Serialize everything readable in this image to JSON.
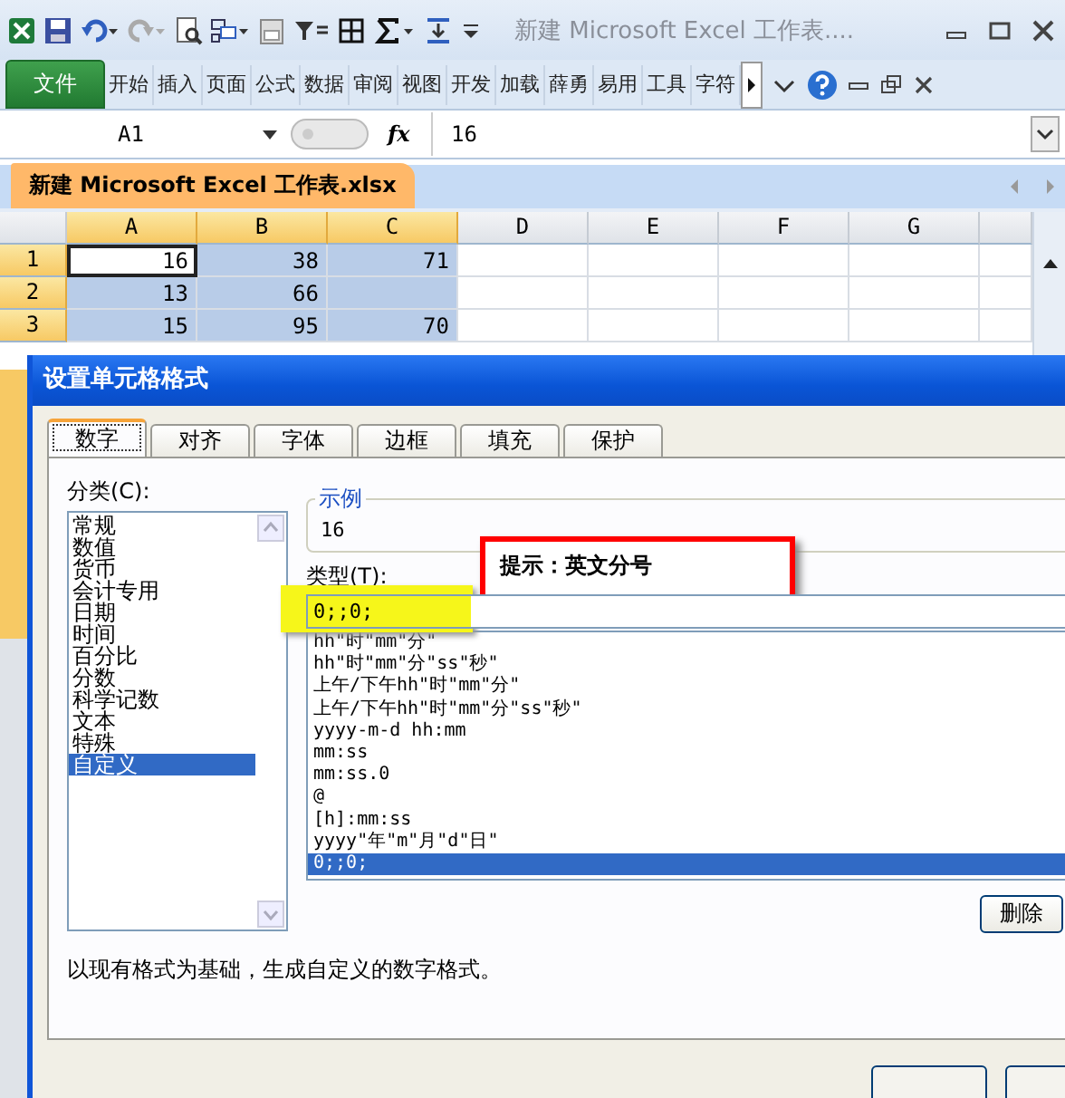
{
  "window": {
    "title": "新建 Microsoft Excel 工作表...."
  },
  "ribbon": {
    "file_tab": "文件",
    "tabs": [
      "开始",
      "插入",
      "页面",
      "公式",
      "数据",
      "审阅",
      "视图",
      "开发",
      "加载",
      "薛勇",
      "易用",
      "工具",
      "字符"
    ]
  },
  "formula_bar": {
    "name_box": "A1",
    "fx": "fx",
    "value": "16"
  },
  "workbook_tab": "新建 Microsoft Excel 工作表.xlsx",
  "sheet": {
    "columns": [
      {
        "label": "A",
        "selected": true
      },
      {
        "label": "B",
        "selected": true
      },
      {
        "label": "C",
        "selected": true
      },
      {
        "label": "D",
        "selected": false
      },
      {
        "label": "E",
        "selected": false
      },
      {
        "label": "F",
        "selected": false
      },
      {
        "label": "G",
        "selected": false
      }
    ],
    "rows": [
      {
        "label": "1",
        "selected": true,
        "cells": [
          {
            "value": "16",
            "active": true
          },
          {
            "value": "38",
            "selected": true,
            "active": false
          },
          {
            "value": "71",
            "selected": true,
            "active": false
          }
        ]
      },
      {
        "label": "2",
        "selected": true,
        "cells": [
          {
            "value": "13",
            "selected": true,
            "active": false
          },
          {
            "value": "66",
            "selected": true,
            "active": false
          },
          {
            "selected": true,
            "active": false
          }
        ]
      },
      {
        "label": "3",
        "selected": true,
        "cells": [
          {
            "value": "15",
            "selected": true,
            "active": false
          },
          {
            "value": "95",
            "selected": true,
            "active": false
          },
          {
            "value": "70",
            "selected": true,
            "active": false
          }
        ]
      }
    ]
  },
  "dialog": {
    "title": "设置单元格格式",
    "tabs": [
      {
        "label": "数字",
        "selected": true
      },
      {
        "label": "对齐",
        "selected": false
      },
      {
        "label": "字体",
        "selected": false
      },
      {
        "label": "边框",
        "selected": false
      },
      {
        "label": "填充",
        "selected": false
      },
      {
        "label": "保护",
        "selected": false
      }
    ],
    "category_label": "分类(C):",
    "categories": [
      {
        "label": "常规",
        "selected": false
      },
      {
        "label": "数值",
        "selected": false
      },
      {
        "label": "货币",
        "selected": false
      },
      {
        "label": "会计专用",
        "selected": false
      },
      {
        "label": "日期",
        "selected": false
      },
      {
        "label": "时间",
        "selected": false
      },
      {
        "label": "百分比",
        "selected": false
      },
      {
        "label": "分数",
        "selected": false
      },
      {
        "label": "科学记数",
        "selected": false
      },
      {
        "label": "文本",
        "selected": false
      },
      {
        "label": "特殊",
        "selected": false
      },
      {
        "label": "自定义",
        "selected": true
      }
    ],
    "sample_label": "示例",
    "sample_value": "16",
    "type_label": "类型(T):",
    "type_value": "0;;0;",
    "types": [
      {
        "label": "hh\"时\"mm\"分\"",
        "selected": false
      },
      {
        "label": "hh\"时\"mm\"分\"ss\"秒\"",
        "selected": false
      },
      {
        "label": "上午/下午hh\"时\"mm\"分\"",
        "selected": false
      },
      {
        "label": "上午/下午hh\"时\"mm\"分\"ss\"秒\"",
        "selected": false
      },
      {
        "label": "yyyy-m-d hh:mm",
        "selected": false
      },
      {
        "label": "mm:ss",
        "selected": false
      },
      {
        "label": "mm:ss.0",
        "selected": false
      },
      {
        "label": "@",
        "selected": false
      },
      {
        "label": "[h]:mm:ss",
        "selected": false
      },
      {
        "label": "yyyy\"年\"m\"月\"d\"日\"",
        "selected": false
      },
      {
        "label": "0;;0;",
        "selected": true
      }
    ],
    "delete_button": "删除",
    "description": "以现有格式为基础，生成自定义的数字格式。"
  },
  "annotation": {
    "text": "提示：英文分号"
  }
}
